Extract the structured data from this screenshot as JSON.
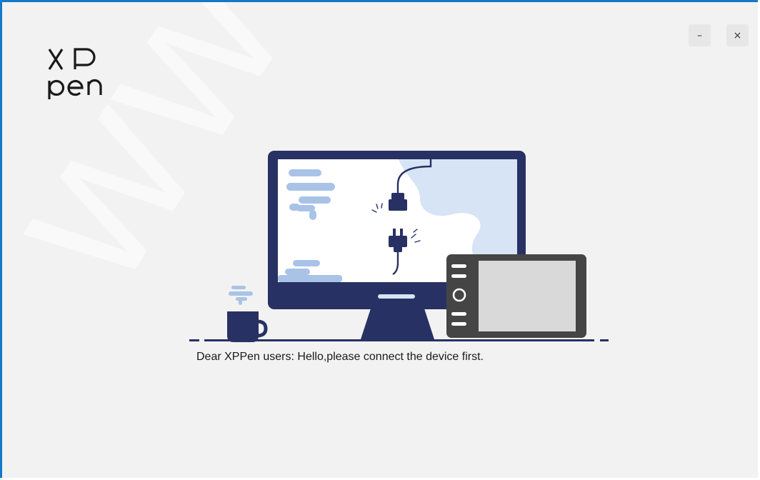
{
  "window": {
    "accent_color": "#1479c9",
    "background_color": "#f2f2f2"
  },
  "logo": {
    "text_line1": "XP",
    "text_line2": "pen"
  },
  "watermark": {
    "text": "www.XP"
  },
  "controls": {
    "minimize_label": "–",
    "close_label": "×"
  },
  "message": {
    "text": "Dear XPPen users: Hello,please connect the device first."
  },
  "illustration": {
    "icons": [
      "monitor-icon",
      "plug-icon",
      "socket-icon",
      "coffee-mug-icon",
      "drawing-tablet-icon"
    ],
    "colors": {
      "navy": "#283163",
      "light_blue": "#a9c3e7",
      "pale_blue": "#d6e4f5",
      "tablet_screen": "#d9d9d9",
      "tablet_body": "#454545"
    }
  }
}
